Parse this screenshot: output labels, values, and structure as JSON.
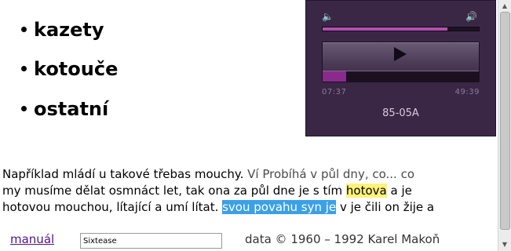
{
  "list": {
    "items": [
      "kazety",
      "kotouče",
      "ostatní"
    ]
  },
  "player": {
    "volume_level": 0.8,
    "progress_level": 0.15,
    "current_time": "07:37",
    "total_time": "49:39",
    "track_name": "85-05A",
    "icons": {
      "volume_low": "speaker-low-icon",
      "volume_high": "speaker-high-icon",
      "play": "play-icon"
    },
    "colors": {
      "background": "#3a2745",
      "accent": "#b44fb0",
      "text": "#d8ccde"
    }
  },
  "paragraph": {
    "line1": {
      "start": "Například mládí u takové třebas mouchy. ",
      "faded": "Ví Probíhá v půl dny, co... co"
    },
    "line2": {
      "before": "my musíme dělat osmnáct let, tak ona za půl dne je s tím ",
      "highlight": "hotova",
      "after": " a je"
    },
    "line3": {
      "before": "hotovou mouchou, lítající a umí lítat. ",
      "highlight": "svou povahu syn je",
      "after": " v je čili on žije a"
    },
    "colors": {
      "highlight_yellow": "#fff27a",
      "highlight_blue": "#3aa0e8"
    }
  },
  "footer": {
    "manual_link": "manuál",
    "search_value": "Sixtease",
    "copyright": "data © 1960 – 1992 Karel Makoň"
  }
}
